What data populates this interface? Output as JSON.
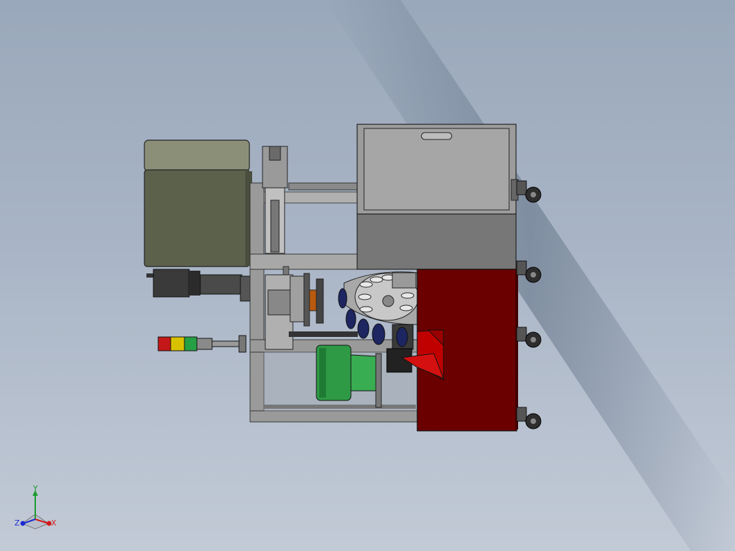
{
  "viewport": {
    "background_top": "#9aa8bb",
    "background_bottom": "#c2cad6",
    "streak_color": "#5f6f84"
  },
  "model": {
    "colors": {
      "cabinet_olive": "#5c614c",
      "cabinet_olive_light": "#8b8f78",
      "frame_gray": "#9a9a9a",
      "frame_dark": "#6f6f6f",
      "hopper_light": "#9c9c9c",
      "hopper_dark": "#777777",
      "base_red": "#6a0000",
      "chute_red": "#c00000",
      "motor_green": "#2e9a45",
      "rotary_gray": "#b5b5b5",
      "cup_navy": "#1d2660",
      "stack_red": "#c41818",
      "stack_yellow": "#d8c200",
      "stack_green": "#25a045",
      "wheel_dark": "#2e2e2e"
    }
  },
  "triad": {
    "y_label": "Y",
    "x_label": "X",
    "z_label": "Z",
    "y_color": "#1a9a2a",
    "x_color": "#d11a1a",
    "z_color": "#1a2ad1"
  }
}
